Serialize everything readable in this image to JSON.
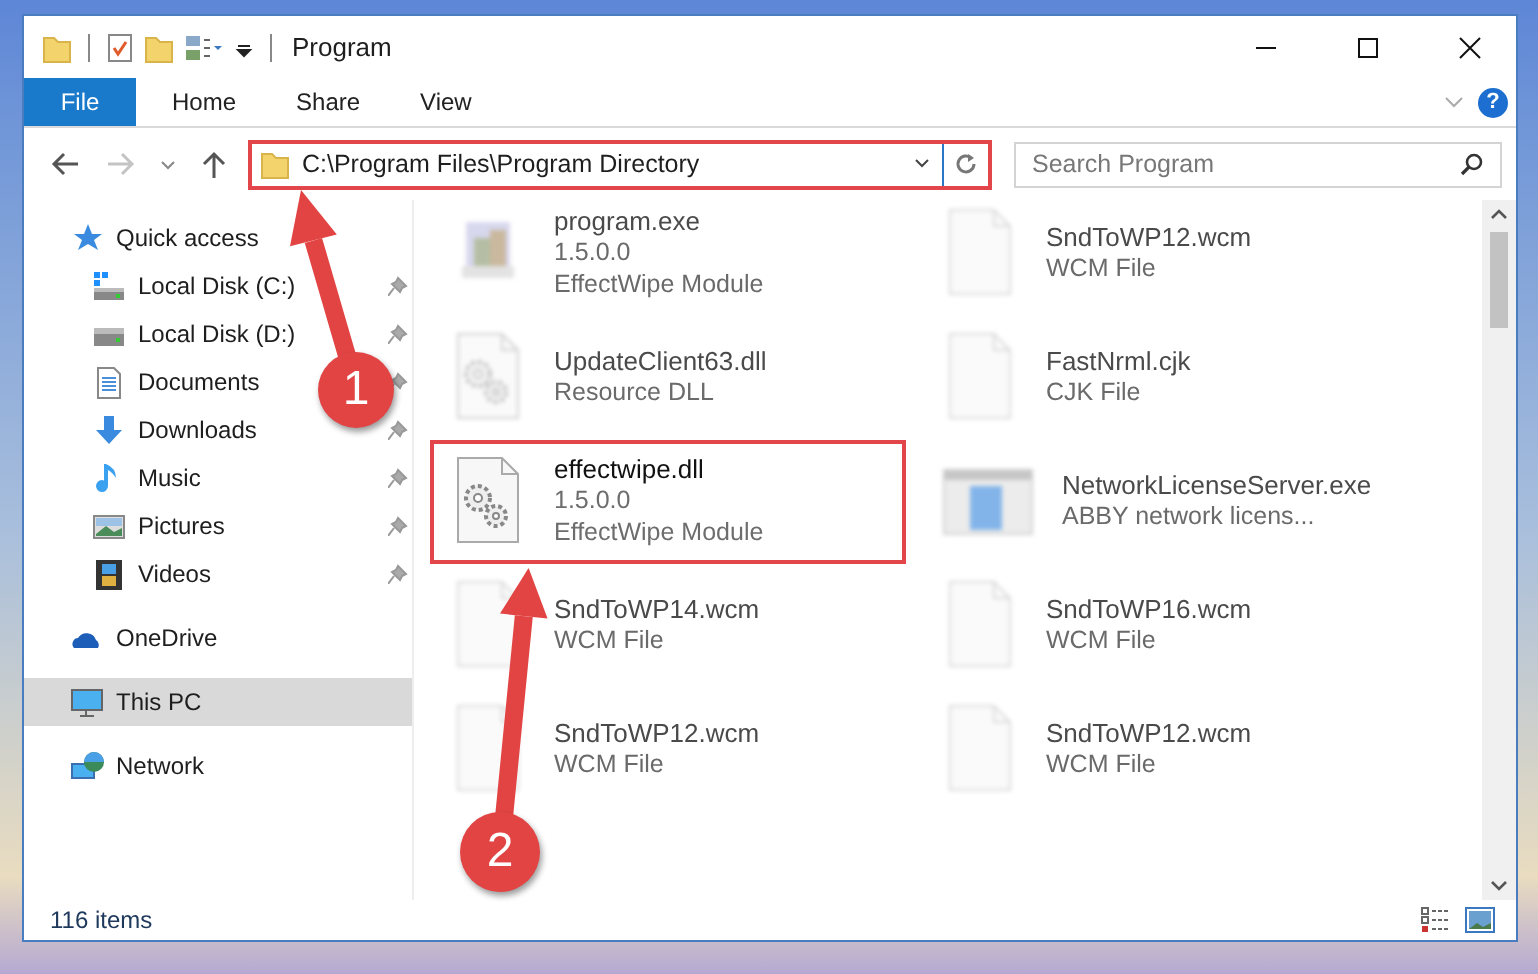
{
  "window": {
    "title": "Program"
  },
  "ribbon": {
    "tabs": [
      {
        "label": "File",
        "kind": "file"
      },
      {
        "label": "Home",
        "kind": "tab"
      },
      {
        "label": "Share",
        "kind": "tab"
      },
      {
        "label": "View",
        "kind": "tab"
      }
    ],
    "help": "?"
  },
  "address_bar": {
    "path": "C:\\Program Files\\Program Directory",
    "highlighted": true
  },
  "search": {
    "placeholder": "Search Program"
  },
  "sidebar": {
    "items": [
      {
        "label": "Quick access",
        "kind": "star",
        "selected": false,
        "children": [
          {
            "label": "Local Disk (C:)",
            "kind": "drive-c",
            "pinned": true,
            "selected": false
          },
          {
            "label": "Local Disk (D:)",
            "kind": "drive",
            "pinned": true,
            "selected": false
          },
          {
            "label": "Documents",
            "kind": "documents",
            "pinned": true,
            "selected": false
          },
          {
            "label": "Downloads",
            "kind": "downloads",
            "pinned": true,
            "selected": false
          },
          {
            "label": "Music",
            "kind": "music",
            "pinned": true,
            "selected": false
          },
          {
            "label": "Pictures",
            "kind": "pictures",
            "pinned": true,
            "selected": false
          },
          {
            "label": "Videos",
            "kind": "videos",
            "pinned": true,
            "selected": false
          }
        ]
      },
      {
        "label": "OneDrive",
        "kind": "cloud",
        "selected": false
      },
      {
        "label": "This PC",
        "kind": "pc",
        "selected": true
      },
      {
        "label": "Network",
        "kind": "network",
        "selected": false
      }
    ]
  },
  "files": [
    {
      "name": "program.exe",
      "lines": [
        "1.5.0.0",
        "EffectWipe Module"
      ],
      "kind": "app",
      "blurred": true,
      "highlighted": false
    },
    {
      "name": "SndToWP12.wcm",
      "lines": [
        "WCM File"
      ],
      "kind": "blank",
      "blurred": true,
      "highlighted": false
    },
    {
      "name": "UpdateClient63.dll",
      "lines": [
        "Resource DLL"
      ],
      "kind": "gear",
      "blurred": true,
      "highlighted": false
    },
    {
      "name": "FastNrml.cjk",
      "lines": [
        "CJK File"
      ],
      "kind": "blank",
      "blurred": true,
      "highlighted": false
    },
    {
      "name": "effectwipe.dll",
      "lines": [
        "1.5.0.0",
        "EffectWipe Module"
      ],
      "kind": "gear",
      "blurred": false,
      "highlighted": true
    },
    {
      "name": "NetworkLicenseServer.exe",
      "lines": [
        "ABBY network licens..."
      ],
      "kind": "window",
      "blurred": true,
      "highlighted": false
    },
    {
      "name": "SndToWP14.wcm",
      "lines": [
        "WCM File"
      ],
      "kind": "blank",
      "blurred": true,
      "highlighted": false
    },
    {
      "name": "SndToWP16.wcm",
      "lines": [
        "WCM File"
      ],
      "kind": "blank",
      "blurred": true,
      "highlighted": false
    },
    {
      "name": "SndToWP12.wcm",
      "lines": [
        "WCM File"
      ],
      "kind": "blank",
      "blurred": true,
      "highlighted": false
    },
    {
      "name": "SndToWP12.wcm",
      "lines": [
        "WCM File"
      ],
      "kind": "blank",
      "blurred": true,
      "highlighted": false
    }
  ],
  "status_bar": {
    "count": "116 items"
  },
  "annotations": [
    {
      "number": "1"
    },
    {
      "number": "2"
    }
  ]
}
